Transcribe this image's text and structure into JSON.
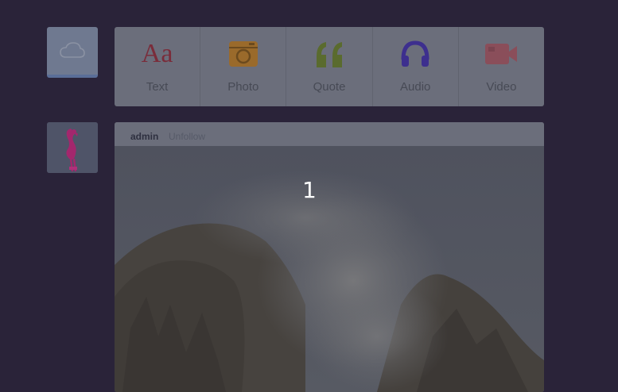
{
  "avatars": {
    "top_icon": "cloud-icon",
    "post_icon": "flamingo-avatar"
  },
  "post_types": [
    {
      "label": "Text",
      "icon": "text-icon",
      "glyph": "Aa",
      "color": "#7a2c3a"
    },
    {
      "label": "Photo",
      "icon": "camera-icon",
      "color": "#9a6a2b"
    },
    {
      "label": "Quote",
      "icon": "quote-icon",
      "glyph": "“",
      "color": "#5a6b2e"
    },
    {
      "label": "Audio",
      "icon": "headphones-icon",
      "color": "#3d2f8e"
    },
    {
      "label": "Video",
      "icon": "video-camera-icon",
      "color": "#8a4e5a"
    }
  ],
  "post": {
    "author": "admin",
    "follow_label": "Unfollow",
    "image_icon": "mountain-photo"
  },
  "overlay": {
    "step_number": "1"
  },
  "colors": {
    "background": "#2a2339",
    "panel": "#6b6e7b"
  }
}
